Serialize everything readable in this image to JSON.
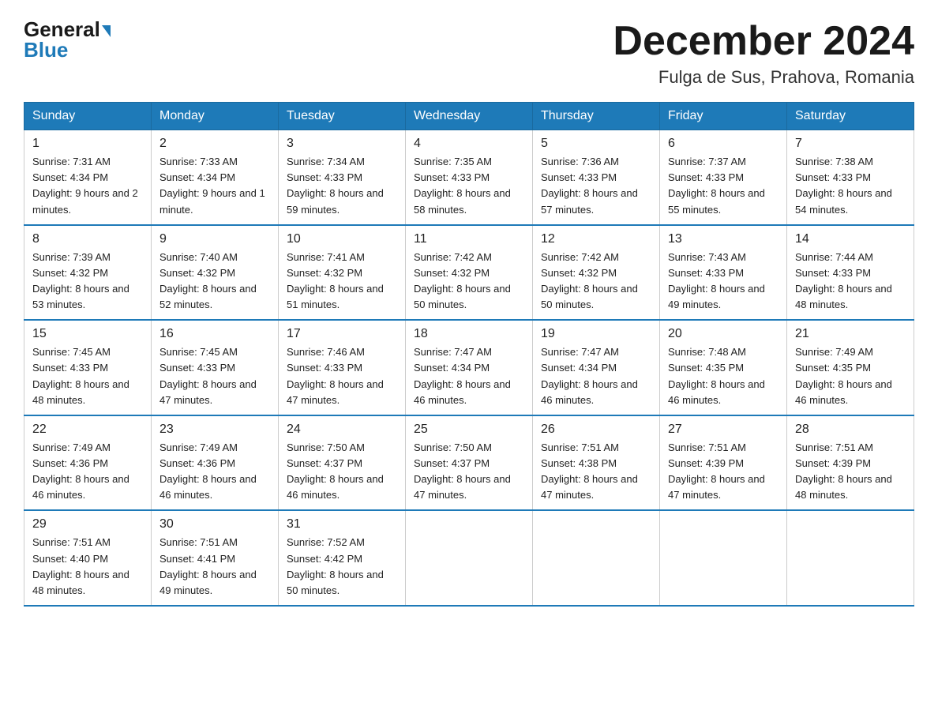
{
  "logo": {
    "general": "General",
    "blue": "Blue"
  },
  "title": "December 2024",
  "subtitle": "Fulga de Sus, Prahova, Romania",
  "days_of_week": [
    "Sunday",
    "Monday",
    "Tuesday",
    "Wednesday",
    "Thursday",
    "Friday",
    "Saturday"
  ],
  "weeks": [
    [
      {
        "num": "1",
        "sunrise": "7:31 AM",
        "sunset": "4:34 PM",
        "daylight": "9 hours and 2 minutes."
      },
      {
        "num": "2",
        "sunrise": "7:33 AM",
        "sunset": "4:34 PM",
        "daylight": "9 hours and 1 minute."
      },
      {
        "num": "3",
        "sunrise": "7:34 AM",
        "sunset": "4:33 PM",
        "daylight": "8 hours and 59 minutes."
      },
      {
        "num": "4",
        "sunrise": "7:35 AM",
        "sunset": "4:33 PM",
        "daylight": "8 hours and 58 minutes."
      },
      {
        "num": "5",
        "sunrise": "7:36 AM",
        "sunset": "4:33 PM",
        "daylight": "8 hours and 57 minutes."
      },
      {
        "num": "6",
        "sunrise": "7:37 AM",
        "sunset": "4:33 PM",
        "daylight": "8 hours and 55 minutes."
      },
      {
        "num": "7",
        "sunrise": "7:38 AM",
        "sunset": "4:33 PM",
        "daylight": "8 hours and 54 minutes."
      }
    ],
    [
      {
        "num": "8",
        "sunrise": "7:39 AM",
        "sunset": "4:32 PM",
        "daylight": "8 hours and 53 minutes."
      },
      {
        "num": "9",
        "sunrise": "7:40 AM",
        "sunset": "4:32 PM",
        "daylight": "8 hours and 52 minutes."
      },
      {
        "num": "10",
        "sunrise": "7:41 AM",
        "sunset": "4:32 PM",
        "daylight": "8 hours and 51 minutes."
      },
      {
        "num": "11",
        "sunrise": "7:42 AM",
        "sunset": "4:32 PM",
        "daylight": "8 hours and 50 minutes."
      },
      {
        "num": "12",
        "sunrise": "7:42 AM",
        "sunset": "4:32 PM",
        "daylight": "8 hours and 50 minutes."
      },
      {
        "num": "13",
        "sunrise": "7:43 AM",
        "sunset": "4:33 PM",
        "daylight": "8 hours and 49 minutes."
      },
      {
        "num": "14",
        "sunrise": "7:44 AM",
        "sunset": "4:33 PM",
        "daylight": "8 hours and 48 minutes."
      }
    ],
    [
      {
        "num": "15",
        "sunrise": "7:45 AM",
        "sunset": "4:33 PM",
        "daylight": "8 hours and 48 minutes."
      },
      {
        "num": "16",
        "sunrise": "7:45 AM",
        "sunset": "4:33 PM",
        "daylight": "8 hours and 47 minutes."
      },
      {
        "num": "17",
        "sunrise": "7:46 AM",
        "sunset": "4:33 PM",
        "daylight": "8 hours and 47 minutes."
      },
      {
        "num": "18",
        "sunrise": "7:47 AM",
        "sunset": "4:34 PM",
        "daylight": "8 hours and 46 minutes."
      },
      {
        "num": "19",
        "sunrise": "7:47 AM",
        "sunset": "4:34 PM",
        "daylight": "8 hours and 46 minutes."
      },
      {
        "num": "20",
        "sunrise": "7:48 AM",
        "sunset": "4:35 PM",
        "daylight": "8 hours and 46 minutes."
      },
      {
        "num": "21",
        "sunrise": "7:49 AM",
        "sunset": "4:35 PM",
        "daylight": "8 hours and 46 minutes."
      }
    ],
    [
      {
        "num": "22",
        "sunrise": "7:49 AM",
        "sunset": "4:36 PM",
        "daylight": "8 hours and 46 minutes."
      },
      {
        "num": "23",
        "sunrise": "7:49 AM",
        "sunset": "4:36 PM",
        "daylight": "8 hours and 46 minutes."
      },
      {
        "num": "24",
        "sunrise": "7:50 AM",
        "sunset": "4:37 PM",
        "daylight": "8 hours and 46 minutes."
      },
      {
        "num": "25",
        "sunrise": "7:50 AM",
        "sunset": "4:37 PM",
        "daylight": "8 hours and 47 minutes."
      },
      {
        "num": "26",
        "sunrise": "7:51 AM",
        "sunset": "4:38 PM",
        "daylight": "8 hours and 47 minutes."
      },
      {
        "num": "27",
        "sunrise": "7:51 AM",
        "sunset": "4:39 PM",
        "daylight": "8 hours and 47 minutes."
      },
      {
        "num": "28",
        "sunrise": "7:51 AM",
        "sunset": "4:39 PM",
        "daylight": "8 hours and 48 minutes."
      }
    ],
    [
      {
        "num": "29",
        "sunrise": "7:51 AM",
        "sunset": "4:40 PM",
        "daylight": "8 hours and 48 minutes."
      },
      {
        "num": "30",
        "sunrise": "7:51 AM",
        "sunset": "4:41 PM",
        "daylight": "8 hours and 49 minutes."
      },
      {
        "num": "31",
        "sunrise": "7:52 AM",
        "sunset": "4:42 PM",
        "daylight": "8 hours and 50 minutes."
      },
      null,
      null,
      null,
      null
    ]
  ]
}
